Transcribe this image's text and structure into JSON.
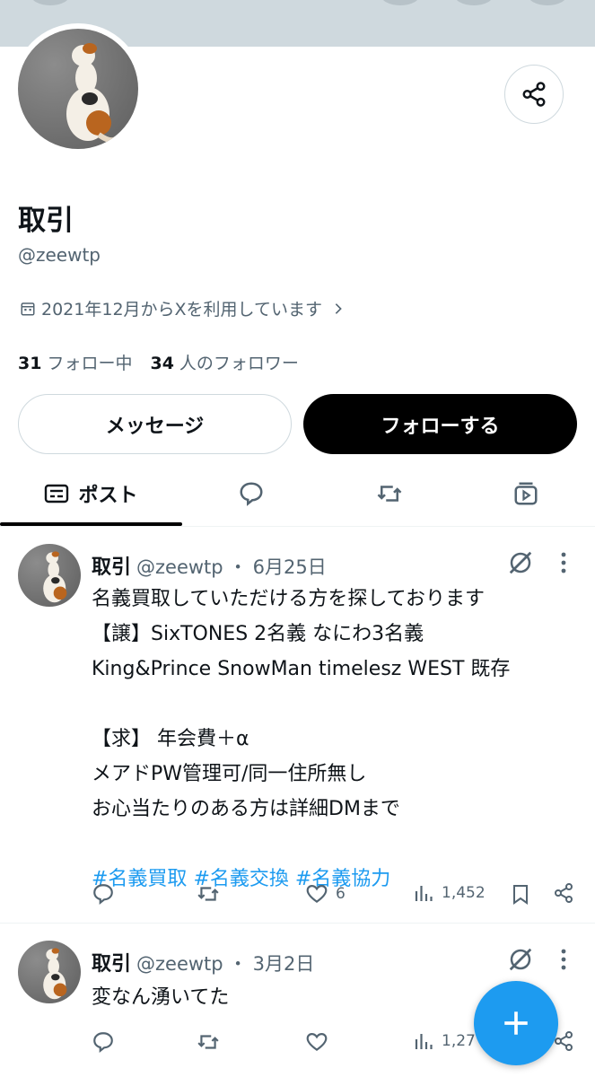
{
  "profile": {
    "name": "取引",
    "handle": "@zeewtp",
    "joined": "2021年12月からXを利用しています",
    "following_count": "31",
    "following_label": "フォロー中",
    "followers_count": "34",
    "followers_label": "人のフォロワー"
  },
  "buttons": {
    "message": "メッセージ",
    "follow": "フォローする"
  },
  "tabs": {
    "posts": "ポスト"
  },
  "posts": [
    {
      "name": "取引",
      "handle": "@zeewtp",
      "sep": "・",
      "date": "6月25日",
      "lines": [
        "名義買取していただける方を探しております",
        "【譲】SixTONES 2名義 なにわ3名義",
        "King&Prince SnowMan timelesz WEST 既存",
        "",
        "【求】 年会費＋α",
        "メアドPW管理可/同一住所無し",
        "お心当たりのある方は詳細DMまで",
        ""
      ],
      "hashtags": [
        "#名義買取",
        "#名義交換",
        "#名義協力"
      ],
      "likes": "6",
      "views": "1,452"
    },
    {
      "name": "取引",
      "handle": "@zeewtp",
      "sep": "・",
      "date": "3月2日",
      "lines": [
        "変なん湧いてた"
      ],
      "views": "1,27"
    }
  ],
  "icons": {
    "share": "share-icon",
    "calendar": "calendar-icon",
    "chevron": "chevron-right-icon",
    "reply": "reply-icon",
    "repost": "repost-icon",
    "like": "heart-icon",
    "views": "views-icon",
    "bookmark": "bookmark-icon",
    "grok": "grok-icon",
    "more": "more-icon",
    "compose": "plus-icon"
  },
  "colors": {
    "accent": "#1d9bf0",
    "text": "#0f1419",
    "muted": "#536471",
    "banner": "#cfd9de"
  }
}
